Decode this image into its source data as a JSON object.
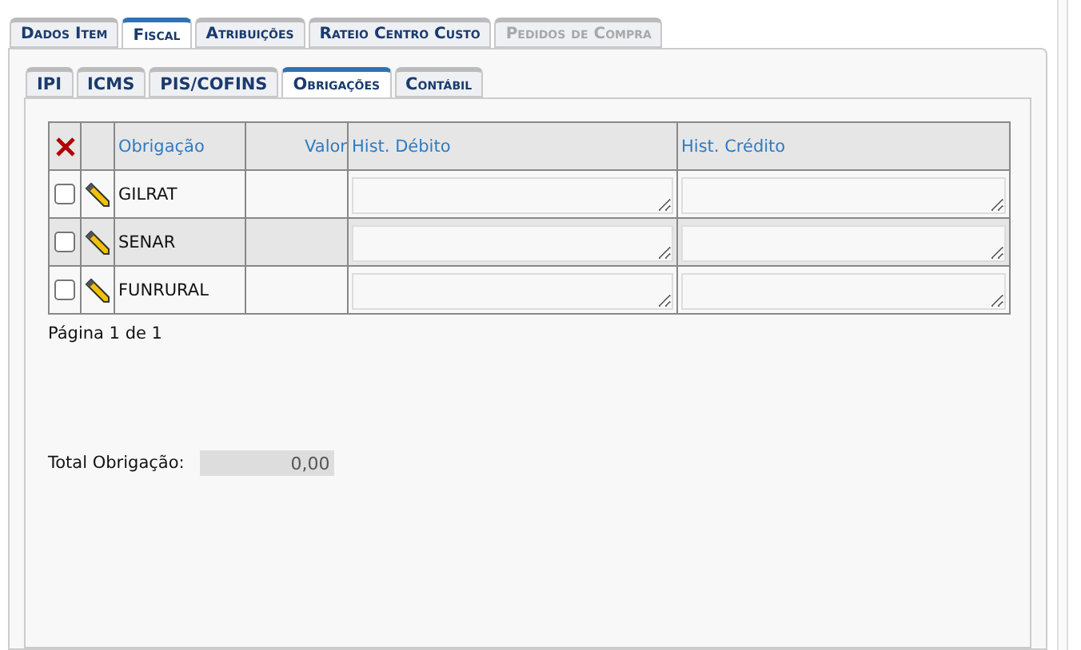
{
  "main_tabs": [
    {
      "label": "Dados Item",
      "selected": false,
      "disabled": false
    },
    {
      "label": "Fiscal",
      "selected": true,
      "disabled": false
    },
    {
      "label": "Atribuições",
      "selected": false,
      "disabled": false
    },
    {
      "label": "Rateio Centro Custo",
      "selected": false,
      "disabled": false
    },
    {
      "label": "Pedidos de Compra",
      "selected": false,
      "disabled": true
    }
  ],
  "sub_tabs": [
    {
      "label": "IPI",
      "selected": false
    },
    {
      "label": "ICMS",
      "selected": false
    },
    {
      "label": "PIS/COFINS",
      "selected": false
    },
    {
      "label": "Obrigações",
      "selected": true
    },
    {
      "label": "Contábil",
      "selected": false
    }
  ],
  "table": {
    "columns": [
      "Obrigação",
      "Valor",
      "Hist. Débito",
      "Hist. Crédito"
    ],
    "rows": [
      {
        "obrigacao": "GILRAT",
        "checked": false,
        "selected": false
      },
      {
        "obrigacao": "SENAR",
        "checked": false,
        "selected": true
      },
      {
        "obrigacao": "FUNRURAL",
        "checked": false,
        "selected": false
      }
    ]
  },
  "pager": "Página 1 de 1",
  "total": {
    "label": "Total Obrigação:",
    "value": "0,00"
  }
}
